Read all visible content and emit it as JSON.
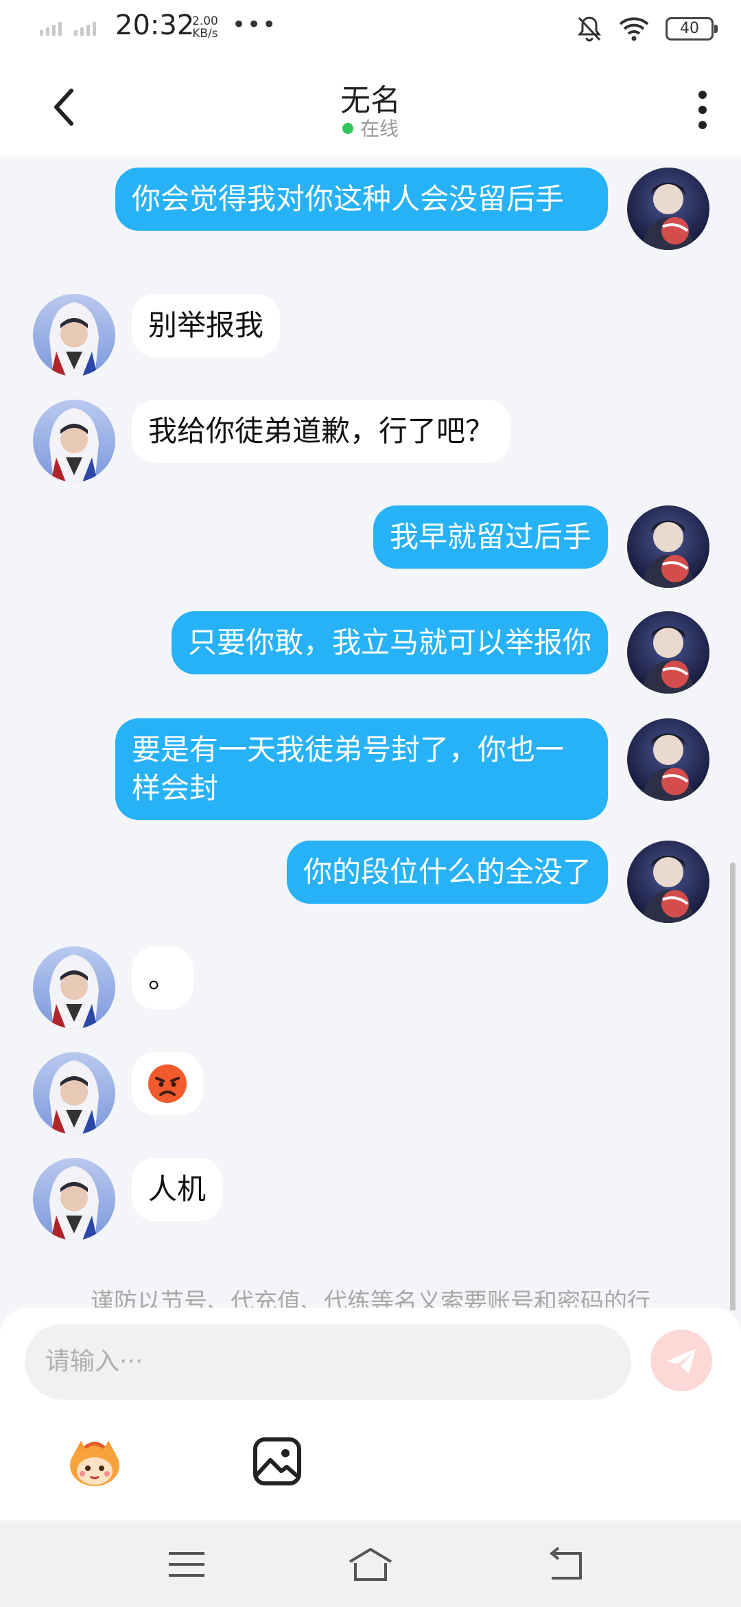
{
  "status_bar": {
    "time": "20:32",
    "speed_value": "2.00",
    "speed_unit": "KB/s",
    "more": "•••",
    "battery": "40"
  },
  "header": {
    "title": "无名",
    "presence": "在线"
  },
  "messages": [
    {
      "from": "self",
      "text": "你会觉得我对你这种人会没留后手"
    },
    {
      "from": "other",
      "text": "别举报我"
    },
    {
      "from": "other",
      "text": "我给你徒弟道歉，行了吧？"
    },
    {
      "from": "self",
      "text": "我早就留过后手"
    },
    {
      "from": "self",
      "text": "只要你敢，我立马就可以举报你"
    },
    {
      "from": "self",
      "text": "要是有一天我徒弟号封了，你也一样会封"
    },
    {
      "from": "self",
      "text": "你的段位什么的全没了"
    },
    {
      "from": "other",
      "text": "。"
    },
    {
      "from": "other",
      "emoji": "angry-face"
    },
    {
      "from": "other",
      "text": "人机"
    }
  ],
  "notice": "谨防以节号、代充值、代练等名义索要账号和密码的行",
  "input": {
    "placeholder": "请输入···"
  },
  "colors": {
    "self_bubble": "#27b2f7",
    "other_bubble": "#ffffff",
    "online_dot": "#2fc55c",
    "send_button": "#fcd9d6"
  },
  "icons": [
    "back-icon",
    "more-icon",
    "send-icon",
    "mascot-sticker-icon",
    "image-icon",
    "menu-icon",
    "home-icon",
    "back-nav-icon"
  ]
}
